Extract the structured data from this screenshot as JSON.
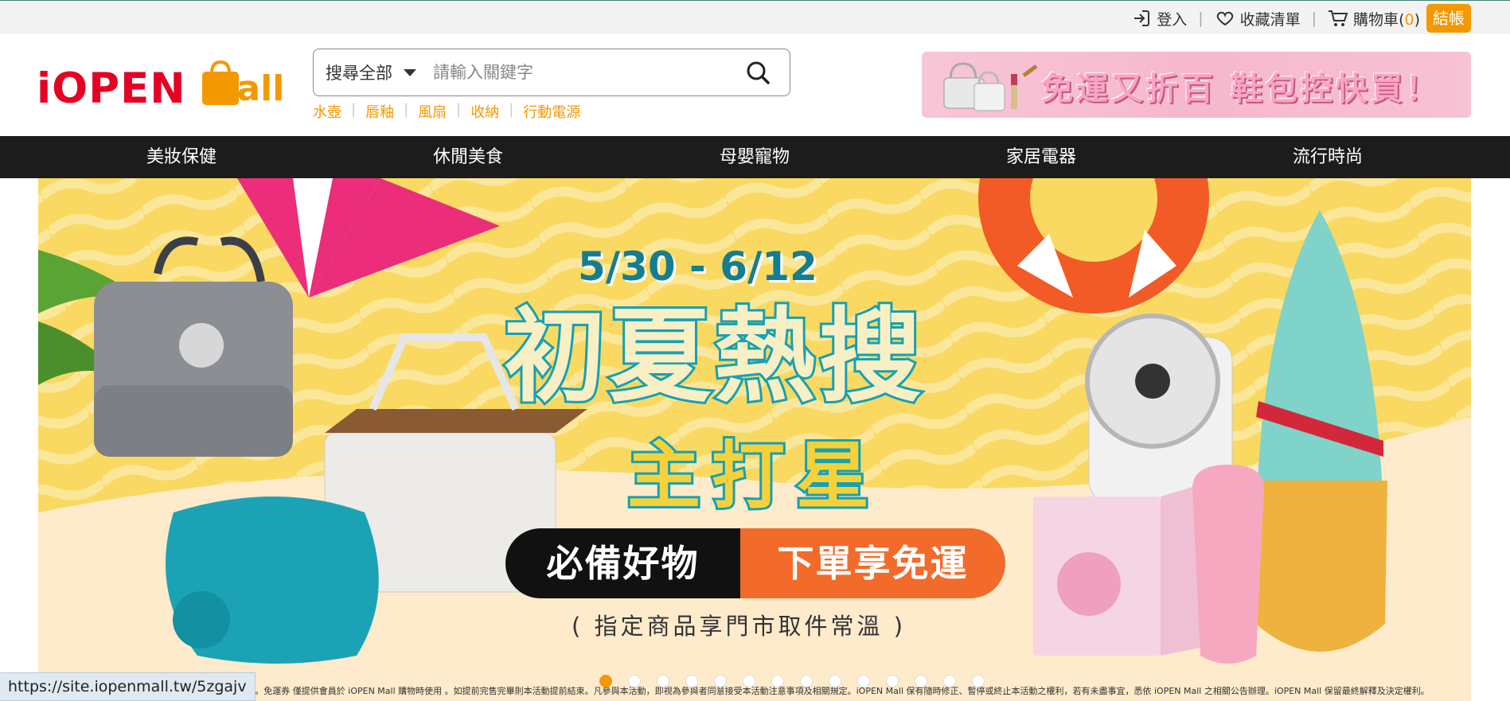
{
  "topbar": {
    "login": "登入",
    "wishlist": "收藏清單",
    "cart_label": "購物車",
    "cart_count": "0",
    "cart_open": "(",
    "cart_close": ")",
    "checkout": "結帳"
  },
  "header": {
    "logo_text": "iOPEN",
    "logo_mall": "Mall",
    "search": {
      "scope": "搜尋全部",
      "placeholder": "請輸入關鍵字"
    },
    "hot_tags": [
      "水壺",
      "唇釉",
      "風扇",
      "收納",
      "行動電源"
    ],
    "promo_text": "免運又折百 鞋包控快買！"
  },
  "categories": [
    "美妝保健",
    "休閒美食",
    "母嬰寵物",
    "家居電器",
    "流行時尚"
  ],
  "hero": {
    "date": "5/30 - 6/12",
    "title1": "初夏熱搜",
    "title2": "主打星",
    "cta_left": "必備好物",
    "cta_right": "下單享免運",
    "note": "( 指定商品享門市取件常溫 )",
    "fineprint": "系統可接單之數量為準。折扣以四捨五入計算。免運券 僅提供會員於 iOPEN Mall 購物時使用 。如提前完售完畢則本活動提前結束。凡參與本活動，即視為參與者同意接受本活動注意事項及相關規定。iOPEN Mall 保有隨時修正、暫停或終止本活動之權利，若有未盡事宜，悉依 iOPEN Mall 之相關公告辦理。iOPEN Mall 保留最終解釋及決定權利。",
    "slide_count": 14,
    "active_slide": 0
  },
  "status_url": "https://site.iopenmall.tw/5zgajv",
  "colors": {
    "brand_red": "#e60023",
    "brand_orange": "#f39800",
    "nav_bg": "#1c1c1c",
    "hero_teal": "#16a0b4"
  }
}
